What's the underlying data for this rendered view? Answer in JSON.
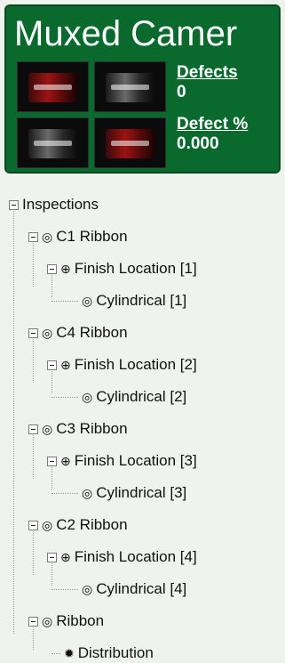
{
  "header": {
    "title": "Muxed Camer",
    "defects_label": "Defects",
    "defects_value": "0",
    "defect_pct_label": "Defect %",
    "defect_pct_value": "0.000",
    "thumbnails": [
      {
        "label": "camera-1-image"
      },
      {
        "label": "camera-2-image"
      },
      {
        "label": "camera-3-image"
      },
      {
        "label": "camera-4-image"
      }
    ]
  },
  "tree": {
    "root": "Inspections",
    "nodes": [
      {
        "label": "C1 Ribbon",
        "icon": "target-icon"
      },
      {
        "label": "Finish Location [1]",
        "icon": "crosshair-icon"
      },
      {
        "label": "Cylindrical [1]",
        "icon": "target-icon"
      },
      {
        "label": "C4 Ribbon",
        "icon": "target-icon"
      },
      {
        "label": "Finish Location [2]",
        "icon": "crosshair-icon"
      },
      {
        "label": "Cylindrical [2]",
        "icon": "target-icon"
      },
      {
        "label": "C3 Ribbon",
        "icon": "target-icon"
      },
      {
        "label": "Finish Location [3]",
        "icon": "crosshair-icon"
      },
      {
        "label": "Cylindrical [3]",
        "icon": "target-icon"
      },
      {
        "label": "C2 Ribbon",
        "icon": "target-icon"
      },
      {
        "label": "Finish Location [4]",
        "icon": "crosshair-icon"
      },
      {
        "label": "Cylindrical [4]",
        "icon": "target-icon"
      },
      {
        "label": "Ribbon",
        "icon": "target-icon"
      },
      {
        "label": "Distribution",
        "icon": "asterisk-icon"
      }
    ]
  },
  "colors": {
    "panel": "#0a6a2e",
    "background": "#eef3ed",
    "text": "#111111"
  }
}
